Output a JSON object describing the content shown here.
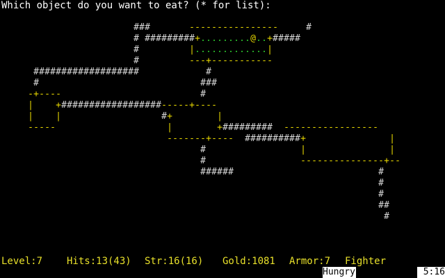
{
  "prompt": "Which object do you want to eat? (* for list):",
  "status": {
    "level": "Level:7",
    "hits": "Hits:13(43)",
    "str": "Str:16(16)",
    "gold": "Gold:1081",
    "armor": "Armor:7",
    "rank": "Fighter"
  },
  "condition": "Hungry",
  "clock": "5:16",
  "colors": {
    "background": "#000000",
    "text": "#ffffff",
    "corridor": "#d8d8d8",
    "wall": "#e8d800",
    "door": "#e8d800",
    "floor": "#2ec82e",
    "player": "#e8d800",
    "status": "#e8e02a"
  },
  "dungeon_rows": [
    "",
    "",
    "                        ###       ----------------     # ",
    "                        # #########+.........@..+##### ",
    "                        #         |.............|      ",
    "                        #         ---+-----------      ",
    "      ###################            #                 ",
    "      #                             ###                ",
    "     -+----                         #                  ",
    "     |    +##################-----+----                ",
    "     |    |                  #+        |               ",
    "     -----                    |        +#########  -----------------",
    "                              -------+----  ##########+               |",
    "                                    #                 |               |",
    "                                    #                 ---------------+--",
    "                                    ######                          #",
    "                                                                    #",
    "                                                                    #",
    "                                                                    ##",
    "                                                                     #"
  ]
}
